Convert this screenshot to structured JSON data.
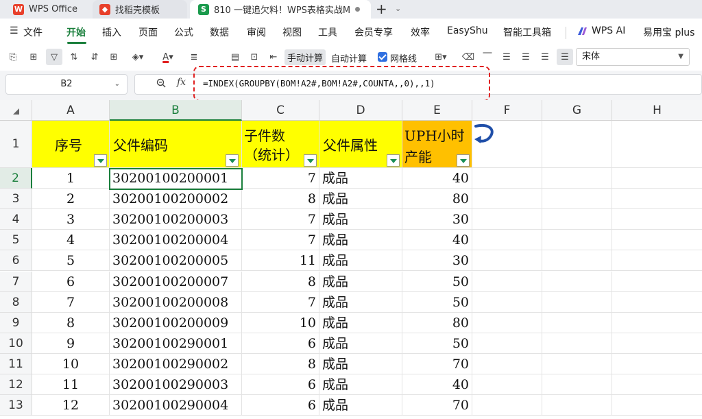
{
  "tabs": [
    {
      "label": "WPS Office"
    },
    {
      "label": "找稻壳模板"
    },
    {
      "label": "810 一键追欠料！WPS表格实战M"
    }
  ],
  "new_tab": "+",
  "menu": {
    "file": "文件",
    "items": [
      "开始",
      "插入",
      "页面",
      "公式",
      "数据",
      "审阅",
      "视图",
      "工具",
      "会员专享",
      "效率",
      "EasyShu",
      "智能工具箱",
      "WPS AI",
      "易用宝 plus"
    ]
  },
  "toolbar": {
    "manual_calc": "手动计算",
    "auto_calc": "自动计算",
    "gridlines": "网格线",
    "font_name": "宋体",
    "font_color": "#e02020"
  },
  "formula_bar": {
    "cell_ref": "B2",
    "fx": "fx",
    "formula": "=INDEX(GROUPBY(BOM!A2#,BOM!A2#,COUNTA,,0),,1)"
  },
  "sheet": {
    "columns": [
      "A",
      "B",
      "C",
      "D",
      "E",
      "F",
      "G",
      "H"
    ],
    "row_numbers": [
      "1",
      "2",
      "3",
      "4",
      "5",
      "6",
      "7",
      "8",
      "9",
      "10",
      "11",
      "12",
      "13"
    ],
    "header": {
      "a": "序号",
      "b": "父件编码",
      "c1": "子件数",
      "c2": "（统计）",
      "d": "父件属性",
      "e1": "UPH小时",
      "e2": "产能"
    },
    "rows": [
      {
        "no": "1",
        "code": "30200100200001",
        "count": "7",
        "attr": "成品",
        "uph": "40"
      },
      {
        "no": "2",
        "code": "30200100200002",
        "count": "8",
        "attr": "成品",
        "uph": "80"
      },
      {
        "no": "3",
        "code": "30200100200003",
        "count": "7",
        "attr": "成品",
        "uph": "30"
      },
      {
        "no": "4",
        "code": "30200100200004",
        "count": "7",
        "attr": "成品",
        "uph": "40"
      },
      {
        "no": "5",
        "code": "30200100200005",
        "count": "11",
        "attr": "成品",
        "uph": "30"
      },
      {
        "no": "6",
        "code": "30200100200007",
        "count": "8",
        "attr": "成品",
        "uph": "50"
      },
      {
        "no": "7",
        "code": "30200100200008",
        "count": "7",
        "attr": "成品",
        "uph": "50"
      },
      {
        "no": "8",
        "code": "30200100200009",
        "count": "10",
        "attr": "成品",
        "uph": "80"
      },
      {
        "no": "9",
        "code": "30200100290001",
        "count": "6",
        "attr": "成品",
        "uph": "50"
      },
      {
        "no": "10",
        "code": "30200100290002",
        "count": "8",
        "attr": "成品",
        "uph": "70"
      },
      {
        "no": "11",
        "code": "30200100290003",
        "count": "6",
        "attr": "成品",
        "uph": "40"
      },
      {
        "no": "12",
        "code": "30200100290004",
        "count": "6",
        "attr": "成品",
        "uph": "70"
      }
    ]
  },
  "colors": {
    "accent": "#1a7f3c",
    "header_yellow": "#ffff00",
    "header_orange": "#ffc000",
    "highlight": "#e02020"
  }
}
